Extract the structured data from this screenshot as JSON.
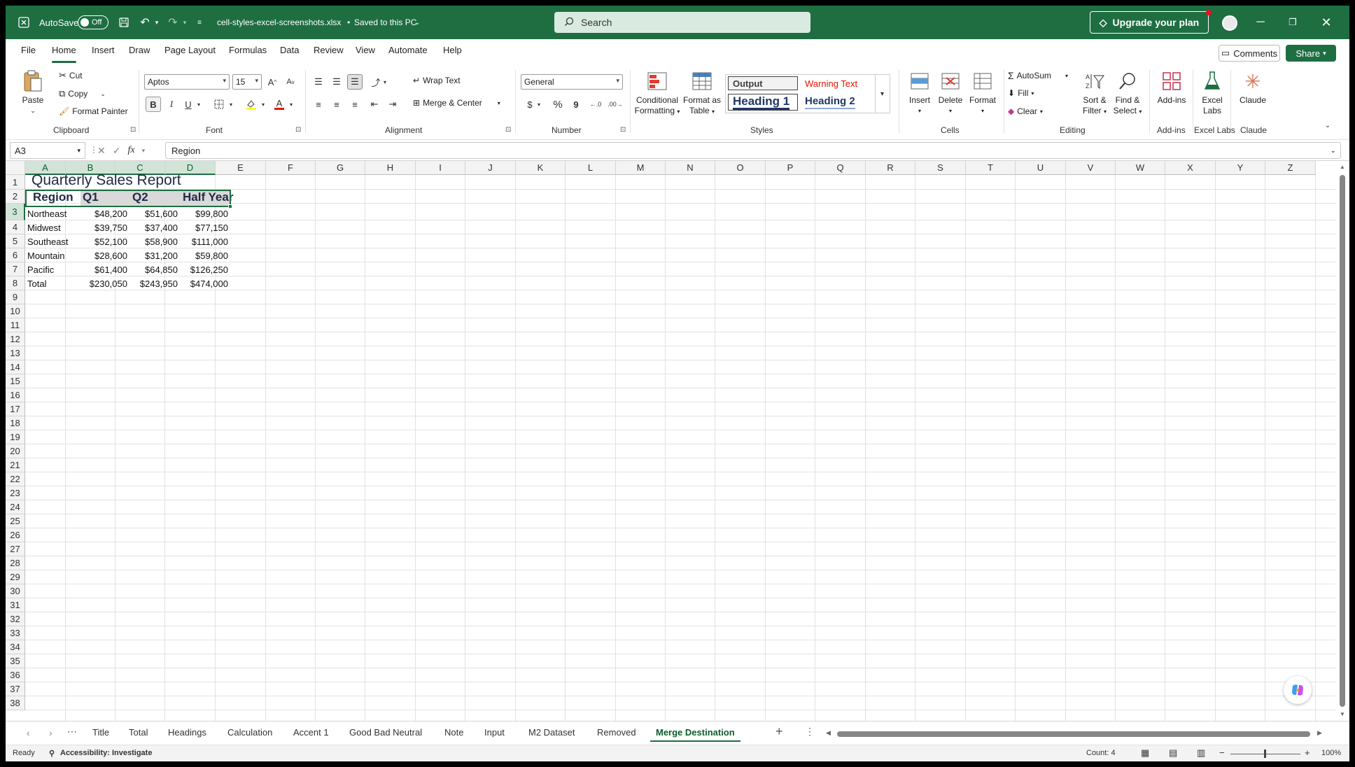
{
  "titlebar": {
    "autosave_label": "AutoSave",
    "autosave_state": "Off",
    "filename": "cell-styles-excel-screenshots.xlsx",
    "save_status": "Saved to this PC",
    "search_placeholder": "Search",
    "upgrade_label": "Upgrade your plan"
  },
  "menu": {
    "tabs": [
      "File",
      "Home",
      "Insert",
      "Draw",
      "Page Layout",
      "Formulas",
      "Data",
      "Review",
      "View",
      "Automate",
      "Help"
    ],
    "active": "Home",
    "comments_label": "Comments",
    "share_label": "Share"
  },
  "ribbon": {
    "clipboard": {
      "paste": "Paste",
      "cut": "Cut",
      "copy": "Copy",
      "format_painter": "Format Painter",
      "label": "Clipboard"
    },
    "font": {
      "name": "Aptos",
      "size": "15",
      "label": "Font",
      "bold": "B",
      "italic": "I",
      "underline": "U"
    },
    "alignment": {
      "wrap_text": "Wrap Text",
      "merge_center": "Merge & Center",
      "label": "Alignment"
    },
    "number": {
      "format": "General",
      "label": "Number",
      "currency": "$",
      "percent": "%",
      "comma": "9"
    },
    "styles": {
      "conditional_1": "Conditional",
      "conditional_2": "Formatting",
      "format_table_1": "Format as",
      "format_table_2": "Table",
      "output": "Output",
      "warning": "Warning Text",
      "heading1": "Heading 1",
      "heading2": "Heading 2",
      "label": "Styles"
    },
    "cells": {
      "insert": "Insert",
      "delete": "Delete",
      "format": "Format",
      "label": "Cells"
    },
    "editing": {
      "autosum": "AutoSum",
      "fill": "Fill",
      "clear": "Clear",
      "sort_1": "Sort &",
      "sort_2": "Filter",
      "find_1": "Find &",
      "find_2": "Select",
      "label": "Editing"
    },
    "addins": {
      "addins": "Add-ins",
      "label": "Add-ins"
    },
    "excel_labs": {
      "name_1": "Excel",
      "name_2": "Labs",
      "label": "Excel Labs"
    },
    "claude": {
      "name": "Claude",
      "label": "Claude"
    }
  },
  "formula_bar": {
    "namebox": "A3",
    "fx": "fx",
    "content": "Region"
  },
  "grid": {
    "columns": [
      "A",
      "B",
      "C",
      "D",
      "E",
      "F",
      "G",
      "H",
      "I",
      "J",
      "K",
      "L",
      "M",
      "N",
      "O",
      "P",
      "Q",
      "R",
      "S",
      "T",
      "U",
      "V",
      "W",
      "X",
      "Y",
      "Z"
    ],
    "rows": [
      "1",
      "2",
      "3",
      "4",
      "5",
      "6",
      "7",
      "8",
      "9",
      "10",
      "11",
      "12",
      "13",
      "14",
      "15",
      "16",
      "17",
      "18",
      "19",
      "20",
      "21",
      "22",
      "23",
      "24",
      "25",
      "26",
      "27",
      "28",
      "29",
      "30",
      "31",
      "32",
      "33",
      "34",
      "35",
      "36",
      "37",
      "38"
    ],
    "title": "Quarterly Sales Report",
    "headers": [
      "Region",
      "Q1",
      "Q2",
      "Half Year"
    ],
    "data": [
      [
        "Northeast",
        "$48,200",
        "$51,600",
        "$99,800"
      ],
      [
        "Midwest",
        "$39,750",
        "$37,400",
        "$77,150"
      ],
      [
        "Southeast",
        "$52,100",
        "$58,900",
        "$111,000"
      ],
      [
        "Mountain",
        "$28,600",
        "$31,200",
        "$59,800"
      ],
      [
        "Pacific",
        "$61,400",
        "$64,850",
        "$126,250"
      ],
      [
        "Total",
        "$230,050",
        "$243,950",
        "$474,000"
      ]
    ]
  },
  "sheets": {
    "tabs": [
      "Title",
      "Total",
      "Headings",
      "Calculation",
      "Accent 1",
      "Good Bad Neutral",
      "Note",
      "Input",
      "M2 Dataset",
      "Removed",
      "Merge Destination"
    ],
    "active": "Merge Destination"
  },
  "status": {
    "ready": "Ready",
    "accessibility": "Accessibility: Investigate",
    "count": "Count: 4",
    "zoom": "100%"
  }
}
